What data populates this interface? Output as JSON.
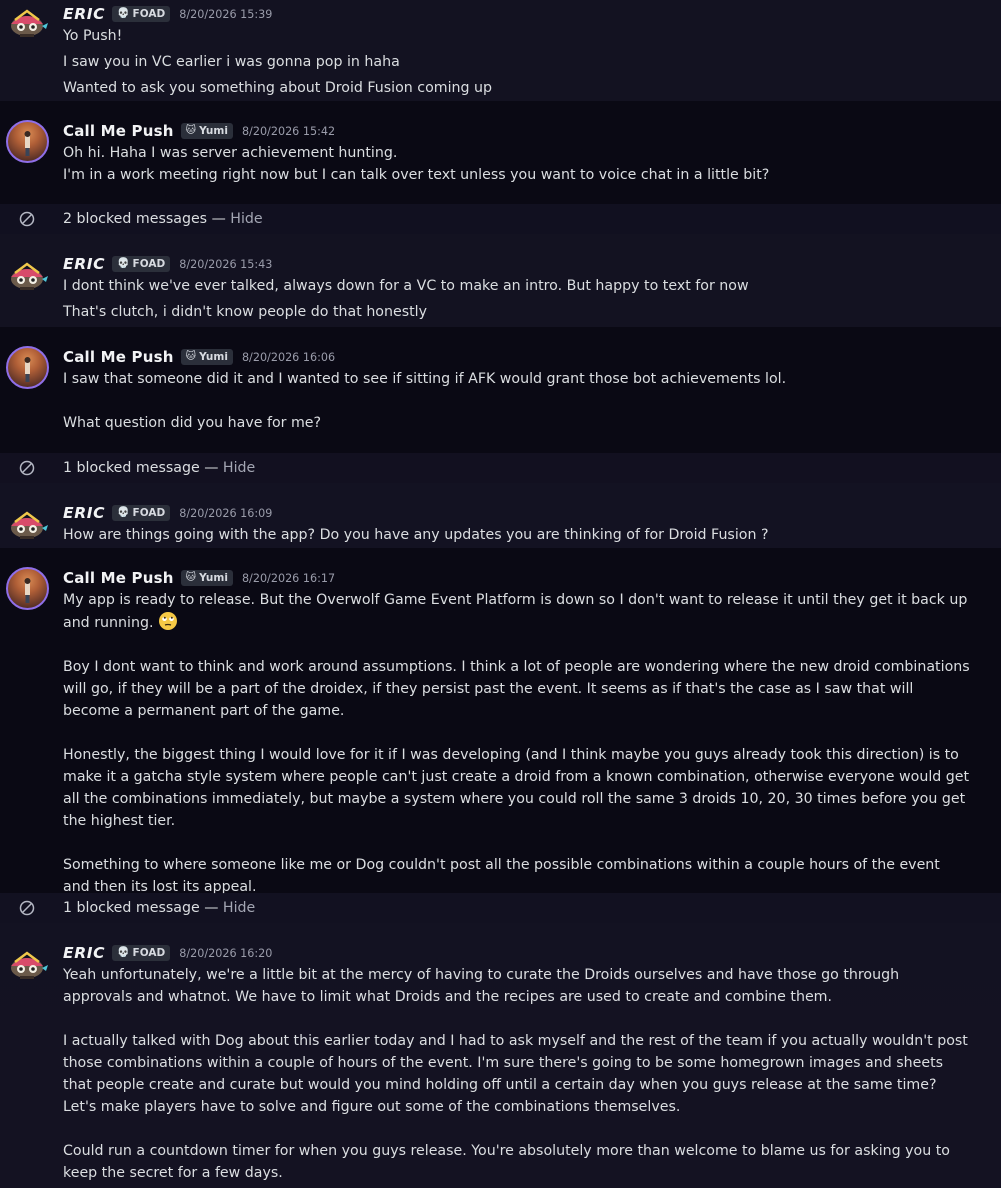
{
  "messages": [
    {
      "author": "ERIC",
      "tag": "FOAD",
      "tag_icon": "skull-icon",
      "timestamp": "8/20/2026 15:39",
      "lines": [
        "Yo Push!",
        "I saw you in VC earlier i was gonna pop in haha",
        "Wanted to ask you something about Droid Fusion coming up"
      ]
    },
    {
      "author": "Call Me Push",
      "tag": "Yumi",
      "tag_icon": "cat-icon",
      "timestamp": "8/20/2026 15:42",
      "lines": [
        "Oh hi. Haha I was server achievement hunting.",
        "I'm in a work meeting right now but I can talk over text unless you want to voice chat in a little bit?"
      ]
    },
    {
      "blocked": "2 blocked messages",
      "hide": "Hide"
    },
    {
      "author": "ERIC",
      "tag": "FOAD",
      "tag_icon": "skull-icon",
      "timestamp": "8/20/2026 15:43",
      "lines": [
        "I dont think we've ever talked, always down for a VC to make an intro.  But happy to text for now",
        "That's clutch, i didn't know people do that honestly"
      ]
    },
    {
      "author": "Call Me Push",
      "tag": "Yumi",
      "tag_icon": "cat-icon",
      "timestamp": "8/20/2026 16:06",
      "lines": [
        "I saw that someone did it and I wanted to see if sitting if AFK would grant those bot achievements lol.",
        "",
        "What question did you have for me?"
      ]
    },
    {
      "blocked": "1 blocked message",
      "hide": "Hide"
    },
    {
      "author": "ERIC",
      "tag": "FOAD",
      "tag_icon": "skull-icon",
      "timestamp": "8/20/2026 16:09",
      "lines": [
        "How are things going with the app?  Do you have any updates you are thinking of for Droid Fusion ?"
      ]
    },
    {
      "author": "Call Me Push",
      "tag": "Yumi",
      "tag_icon": "cat-icon",
      "timestamp": "8/20/2026 16:17",
      "paragraphs": [
        "My app is ready to release. But the Overwolf Game Event Platform is down so I don't want to release it until they get it back up and running.",
        "Boy I dont want to think and work around assumptions. I think a lot of people are wondering where the new droid combinations will go, if they will be a part of the droidex, if they persist past the event. It seems as if that's the case as I saw that will become a permanent part of the game.",
        "Honestly, the biggest thing I would love for it if I was developing (and I think maybe you guys already took this direction) is to make it a gatcha style system where people can't just create a droid from a known combination, otherwise everyone would get all the combinations immediately, but maybe a system where you could roll the same 3 droids 10, 20, 30 times before you get the highest tier.",
        "Something to where someone like me or Dog couldn't post all the possible combinations within a couple hours of the event and then its lost its appeal."
      ],
      "emoji": "face-with-rolling-eyes-icon"
    },
    {
      "blocked": "1 blocked message",
      "hide": "Hide"
    },
    {
      "author": "ERIC",
      "tag": "FOAD",
      "tag_icon": "skull-icon",
      "timestamp": "8/20/2026 16:20",
      "paragraphs": [
        "Yeah unfortunately, we're a little bit at the mercy of having to curate the Droids ourselves and have those go through approvals and whatnot. We have to limit what Droids and the recipes are used to create and combine them.",
        "I actually talked with Dog about this earlier today and I had to ask myself and the rest of the team if you actually wouldn't post those combinations within a couple of hours of the event.  I'm sure there's going to be some homegrown images and sheets that people create and curate but would you mind holding off until a certain day when you guys release at the same time? Let's make players have to solve and figure out some of the combinations themselves.",
        "Could run a countdown timer for when you guys release.  You're absolutely more than welcome to blame us for asking you to keep the secret for a few days."
      ]
    }
  ],
  "colors": {
    "background": "#131124",
    "text": "#dbdee1",
    "timestamp": "#9a9caa",
    "push_ring": "#8f6fe8",
    "tag_bg": "#2b2f3a"
  }
}
